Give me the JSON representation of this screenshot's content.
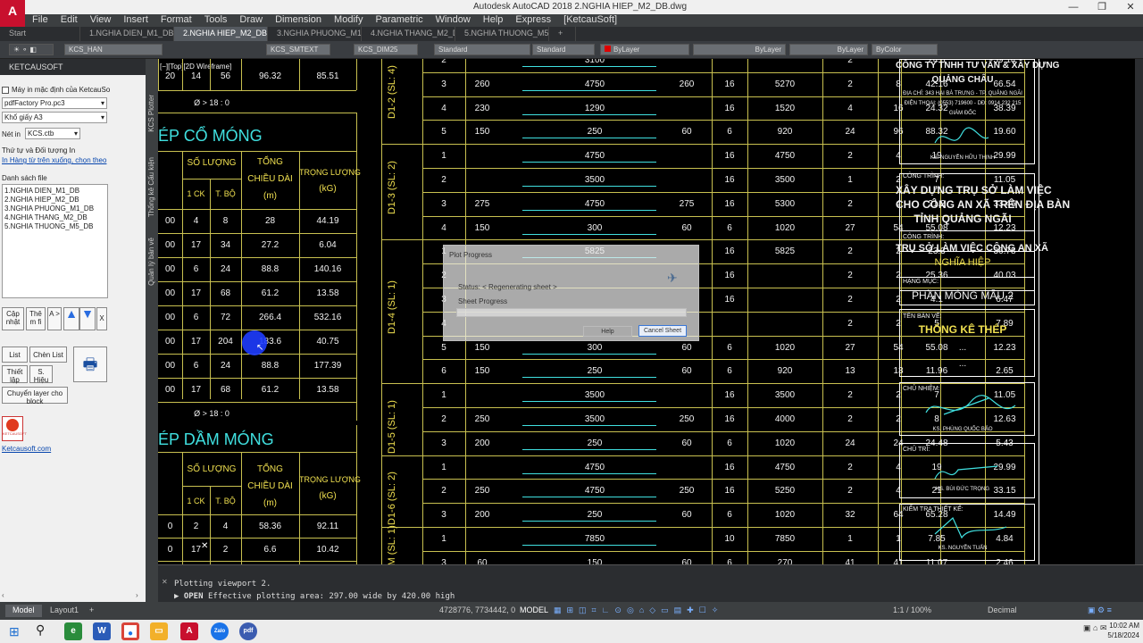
{
  "app": {
    "logo": "A",
    "title": "Autodesk AutoCAD 2018    2.NGHIA HIEP_M2_DB.dwg"
  },
  "menu": [
    "File",
    "Edit",
    "View",
    "Insert",
    "Format",
    "Tools",
    "Draw",
    "Dimension",
    "Modify",
    "Parametric",
    "Window",
    "Help",
    "Express",
    "[KetcauSoft]"
  ],
  "tabs": [
    "Start",
    "1.NGHIA DIEN_M1_DB*",
    "2.NGHIA HIEP_M2_DB",
    "3.NGHIA PHUONG_M1_DB",
    "4.NGHIA THANG_M2_DB",
    "5.NGHIA THUONG_M5_DB*",
    "+"
  ],
  "toolbar": {
    "layer": "KCS_HAN",
    "textstyle": "KCS_SMTEXT",
    "dimstyle": "KCS_DIM25",
    "ml1": "Standard",
    "ml2": "Standard",
    "color": "ByLayer",
    "ltype": "ByLayer",
    "lweight": "ByLayer",
    "plot": "ByColor"
  },
  "panel": {
    "header": "KETCAUSOFT",
    "default_printer_label": "Máy in mặc định của KetcauSo",
    "printer": "pdfFactory Pro.pc3",
    "paper_label": "Khổ giấy A3",
    "pen_label": "Nét in",
    "pen": "KCS.ctb",
    "order_label": "Thứ tự và Đối tượng In",
    "order_link": "In Hàng từ trên xuống, chọn theo",
    "list_label": "Danh sách file",
    "files": [
      "1.NGHIA DIEN_M1_DB",
      "2.NGHIA HIEP_M2_DB",
      "3.NGHIA PHUONG_M1_DB",
      "4.NGHIA THANG_M2_DB",
      "5.NGHIA THUONG_M5_DB"
    ],
    "btn_update": "Cập nhật",
    "btn_them": "Thê m fi",
    "btn_a": "A >",
    "btn_x": "X",
    "btn_list": "List",
    "btn_chenlist": "Chèn List",
    "btn_thietlap": "Thiết lập",
    "btn_shieu": "S. Hiệu",
    "btn_chuyen": "Chuyển layer cho block",
    "logo_text": "KETCAUSOFT",
    "website": "Ketcausoft.com"
  },
  "side_tabs": [
    "KCS Plotter",
    "Thống kê Cấu kiện",
    "Quản lý bản vẽ"
  ],
  "viewport_label": "[−][Top][2D Wireframe]",
  "left_table1": {
    "title": "ÉP CỔ MÓNG",
    "h_soluong": "SỐ LƯỢNG",
    "h_tong": "TỔNG",
    "h_chieudai": "CHIỀU DÀI",
    "h_m": "(m)",
    "h_trong": "TRỌNG LƯỢNG",
    "h_kg": "(kG)",
    "h_1ck": "1 CK",
    "h_tbo": "T. BỘ",
    "top_row": [
      "20",
      "14",
      "56",
      "96.32",
      "85.51"
    ],
    "phi_top": "Ø > 18 : 0",
    "rows": [
      [
        "00",
        "4",
        "8",
        "28",
        "44.19"
      ],
      [
        "00",
        "17",
        "34",
        "27.2",
        "6.04"
      ],
      [
        "00",
        "6",
        "24",
        "88.8",
        "140.16"
      ],
      [
        "00",
        "17",
        "68",
        "61.2",
        "13.58"
      ],
      [
        "00",
        "6",
        "72",
        "266.4",
        "532.16"
      ],
      [
        "00",
        "17",
        "204",
        "183.6",
        "40.75"
      ],
      [
        "00",
        "6",
        "24",
        "88.8",
        "177.39"
      ],
      [
        "00",
        "17",
        "68",
        "61.2",
        "13.58"
      ]
    ],
    "phi_bottom": "Ø > 18 : 0"
  },
  "left_table2": {
    "title": "ÉP DẦM MÓNG",
    "h_soluong": "SỐ LƯỢNG",
    "h_tong": "TỔNG",
    "h_chieudai": "CHIỀU DÀI",
    "h_m": "(m)",
    "h_trong": "TRỌNG LƯỢNG",
    "h_kg": "(kG)",
    "h_1ck": "1 CK",
    "h_tbo": "T. BỘ",
    "rows": [
      [
        "0",
        "2",
        "4",
        "58.36",
        "92.11"
      ],
      [
        "0",
        "17",
        "2",
        "6.6",
        "10.42"
      ]
    ]
  },
  "main_table": {
    "rows": [
      {
        "g": "",
        "n": "2",
        "a": "",
        "b": "3100",
        "c": "",
        "d": "",
        "e": "",
        "f": "2",
        "h": "",
        "i": "24.8",
        "j": "39.14"
      },
      {
        "g": "D1-2 (SL: 4)",
        "n": "3",
        "a": "260",
        "b": "4750",
        "c": "260",
        "d": "16",
        "e": "5270",
        "f": "2",
        "h": "8",
        "i": "42.16",
        "j": "66.54"
      },
      {
        "g": "",
        "n": "4",
        "a": "230",
        "b": "1290",
        "c": "",
        "d": "16",
        "e": "1520",
        "f": "4",
        "h": "16",
        "i": "24.32",
        "j": "38.39"
      },
      {
        "g": "",
        "n": "5",
        "a": "150",
        "b": "250",
        "c": "60",
        "d": "6",
        "e": "920",
        "f": "24",
        "h": "96",
        "i": "88.32",
        "j": "19.60"
      },
      {
        "g": "",
        "n": "1",
        "a": "",
        "b": "4750",
        "c": "",
        "d": "16",
        "e": "4750",
        "f": "2",
        "h": "4",
        "i": "19",
        "j": "29.99"
      },
      {
        "g": "D1-3 (SL: 2)",
        "n": "2",
        "a": "",
        "b": "3500",
        "c": "",
        "d": "16",
        "e": "3500",
        "f": "1",
        "h": "2",
        "i": "7",
        "j": "11.05"
      },
      {
        "g": "",
        "n": "3",
        "a": "275",
        "b": "4750",
        "c": "275",
        "d": "16",
        "e": "5300",
        "f": "2",
        "h": "4",
        "i": "21.2",
        "j": "33.46"
      },
      {
        "g": "",
        "n": "4",
        "a": "150",
        "b": "300",
        "c": "60",
        "d": "6",
        "e": "1020",
        "f": "27",
        "h": "54",
        "i": "55.08",
        "j": "12.23"
      },
      {
        "g": "",
        "n": "1",
        "a": "",
        "b": "5825",
        "c": "",
        "d": "16",
        "e": "5825",
        "f": "2",
        "h": "2",
        "i": "23.3",
        "j": "36.78"
      },
      {
        "g": "",
        "n": "2",
        "a": "",
        "b": "",
        "c": "",
        "d": "16",
        "e": "",
        "f": "2",
        "h": "2",
        "i": "25.36",
        "j": "40.03"
      },
      {
        "g": "D1-4 (SL: 1)",
        "n": "3",
        "a": "",
        "b": "",
        "c": "",
        "d": "16",
        "e": "",
        "f": "2",
        "h": "2",
        "i": "4.1",
        "j": "6.47"
      },
      {
        "g": "",
        "n": "4",
        "a": "",
        "b": "",
        "c": "",
        "d": "",
        "e": "",
        "f": "2",
        "h": "2",
        "i": "5",
        "j": "7.89"
      },
      {
        "g": "",
        "n": "5",
        "a": "150",
        "b": "300",
        "c": "60",
        "d": "6",
        "e": "1020",
        "f": "27",
        "h": "54",
        "i": "55.08",
        "j": "12.23"
      },
      {
        "g": "",
        "n": "6",
        "a": "150",
        "b": "250",
        "c": "60",
        "d": "6",
        "e": "920",
        "f": "13",
        "h": "13",
        "i": "11.96",
        "j": "2.65"
      },
      {
        "g": "",
        "n": "1",
        "a": "",
        "b": "3500",
        "c": "",
        "d": "16",
        "e": "3500",
        "f": "2",
        "h": "2",
        "i": "7",
        "j": "11.05"
      },
      {
        "g": "D1-5 (SL: 1)",
        "n": "2",
        "a": "250",
        "b": "3500",
        "c": "250",
        "d": "16",
        "e": "4000",
        "f": "2",
        "h": "2",
        "i": "8",
        "j": "12.63"
      },
      {
        "g": "",
        "n": "3",
        "a": "200",
        "b": "250",
        "c": "60",
        "d": "6",
        "e": "1020",
        "f": "24",
        "h": "24",
        "i": "24.48",
        "j": "5.43"
      },
      {
        "g": "",
        "n": "1",
        "a": "",
        "b": "4750",
        "c": "",
        "d": "16",
        "e": "4750",
        "f": "2",
        "h": "4",
        "i": "19",
        "j": "29.99"
      },
      {
        "g": "D1-6 (SL: 2)",
        "n": "2",
        "a": "250",
        "b": "4750",
        "c": "250",
        "d": "16",
        "e": "5250",
        "f": "2",
        "h": "4",
        "i": "21",
        "j": "33.15"
      },
      {
        "g": "",
        "n": "3",
        "a": "200",
        "b": "250",
        "c": "60",
        "d": "6",
        "e": "1020",
        "f": "32",
        "h": "64",
        "i": "65.28",
        "j": "14.49"
      },
      {
        "g": "GM (SL: 1)",
        "n": "1",
        "a": "",
        "b": "7850",
        "c": "",
        "d": "10",
        "e": "7850",
        "f": "1",
        "h": "1",
        "i": "7.85",
        "j": "4.84"
      },
      {
        "g": "",
        "n": "3",
        "a": "60",
        "b": "150",
        "c": "60",
        "d": "6",
        "e": "270",
        "f": "41",
        "h": "41",
        "i": "11.07",
        "j": "2.46"
      }
    ]
  },
  "title_block": {
    "company": "CÔNG TY TNHH TƯ VẤN & XÂY DỰNG",
    "company2": "QUẢNG CHÂU",
    "address": "ĐỊA CHỈ: 343 HAI BÀ TRƯNG - TP. QUẢNG NGÃI",
    "phone": "ĐIỆN THOẠI: (0553) 719600 - DĐ: 0914 232 215",
    "director": "GIÁM ĐỐC",
    "director_name": "KS. NGUYỄN HỮU THỊNH",
    "ct_label": "CÔNG TRÌNH:",
    "ct1": "XÂY DỰNG TRỤ SỞ LÀM VIỆC",
    "ct2": "CHO CÔNG AN XÃ TRÊN ĐỊA BÀN",
    "ct3": "TỈNH QUẢNG NGÃI",
    "ct_label2": "CÔNG TRÌNH:",
    "ct4": "TRỤ SỞ LÀM VIỆC CÔNG AN XÃ",
    "ct5": "NGHĨA HIỆP",
    "hm_label": "HẠNG MỤC:",
    "hm": "PHẦN MÓNG MẪU 2",
    "tbv_label": "TÊN BẢN VẼ:",
    "tbv": "THỐNG KÊ THÉP",
    "dots1": "...",
    "dots2": "...",
    "cn_label": "CHỦ NHIỆM:",
    "cn": "KS. PHÙNG QUỐC BẢO",
    "ctri_label": "CHỦ TRÌ:",
    "ctri": "KS. BÙI ĐỨC TRỌNG",
    "kt_label": "KIỂM TRA THIẾT KẾ:",
    "kt": "KS. NGUYỄN TUẤN"
  },
  "dialog": {
    "title": "Plot Progress",
    "status": "Status: < Regenerating sheet >",
    "sheet": "Sheet Progress",
    "help": "Help",
    "cancel": "Cancel Sheet"
  },
  "command": {
    "line1": "Plotting viewport 2.",
    "prefix": "OPEN",
    "line2": "Effective plotting area:  297.00 wide by 420.00 high"
  },
  "status": {
    "model_tab": "Model",
    "layout_tab": "Layout1",
    "coords": "4728776, 7734442, 0",
    "model": "MODEL",
    "scale": "1:1 / 100%",
    "units": "Decimal"
  },
  "taskbar": {
    "time": "10:02 AM",
    "date": "5/18/2024",
    "apps": [
      "W",
      "A",
      "Zalo",
      "pdf"
    ]
  }
}
